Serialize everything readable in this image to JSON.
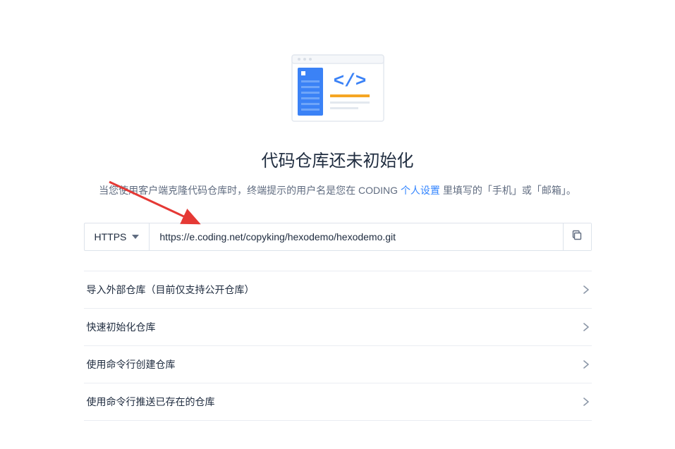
{
  "heading": "代码仓库还未初始化",
  "subheading_prefix": "当您使用客户端克隆代码仓库时，终端提示的用户名是您在 CODING ",
  "subheading_link": "个人设置",
  "subheading_suffix": " 里填写的「手机」或「邮箱」。",
  "protocol": "HTTPS",
  "url": "https://e.coding.net/copyking/hexodemo/hexodemo.git",
  "options": [
    "导入外部仓库（目前仅支持公开仓库）",
    "快速初始化仓库",
    "使用命令行创建仓库",
    "使用命令行推送已存在的仓库"
  ]
}
